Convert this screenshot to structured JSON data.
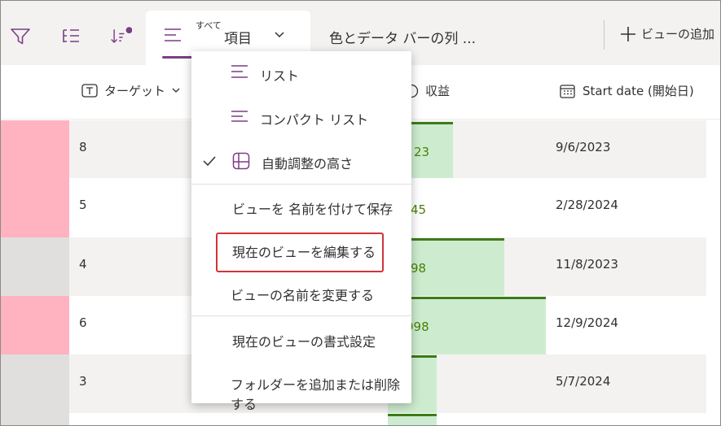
{
  "toolbar": {
    "view_tab_small": "すべて",
    "view_tab_label": "項目",
    "tab2_label": "色とデータ バーの列 ...",
    "add_view_label": "ビューの追加"
  },
  "columns": {
    "target": "ターゲット",
    "revenue": "収益",
    "start_date": "Start date (開始日)"
  },
  "rows": [
    {
      "target": "8",
      "revenue": "23",
      "date": "9/6/2023"
    },
    {
      "target": "5",
      "revenue": "45",
      "date": "2/28/2024"
    },
    {
      "target": "4",
      "revenue": "98",
      "date": "11/8/2023"
    },
    {
      "target": "6",
      "revenue": "998",
      "date": "12/9/2024"
    },
    {
      "target": "3",
      "revenue": "",
      "date": "5/7/2024"
    }
  ],
  "menu": {
    "list": "リスト",
    "compact_list": "コンパクト リスト",
    "autofit_height": "自動調整の高さ",
    "save_view_as": "ビューを 名前を付けて保存",
    "edit_current_view": "現在のビューを編集する",
    "rename_view": "ビューの名前を変更する",
    "format_current_view": "現在のビューの書式設定",
    "add_remove_folders": "フォルダーを追加または削除する"
  },
  "colors": {
    "accent": "#7c3d84",
    "bar_fill": "#cdeccf",
    "bar_line": "#3d7b17",
    "bar_text": "#498205",
    "pink": "#ffb3c1",
    "highlight": "#d13438"
  }
}
